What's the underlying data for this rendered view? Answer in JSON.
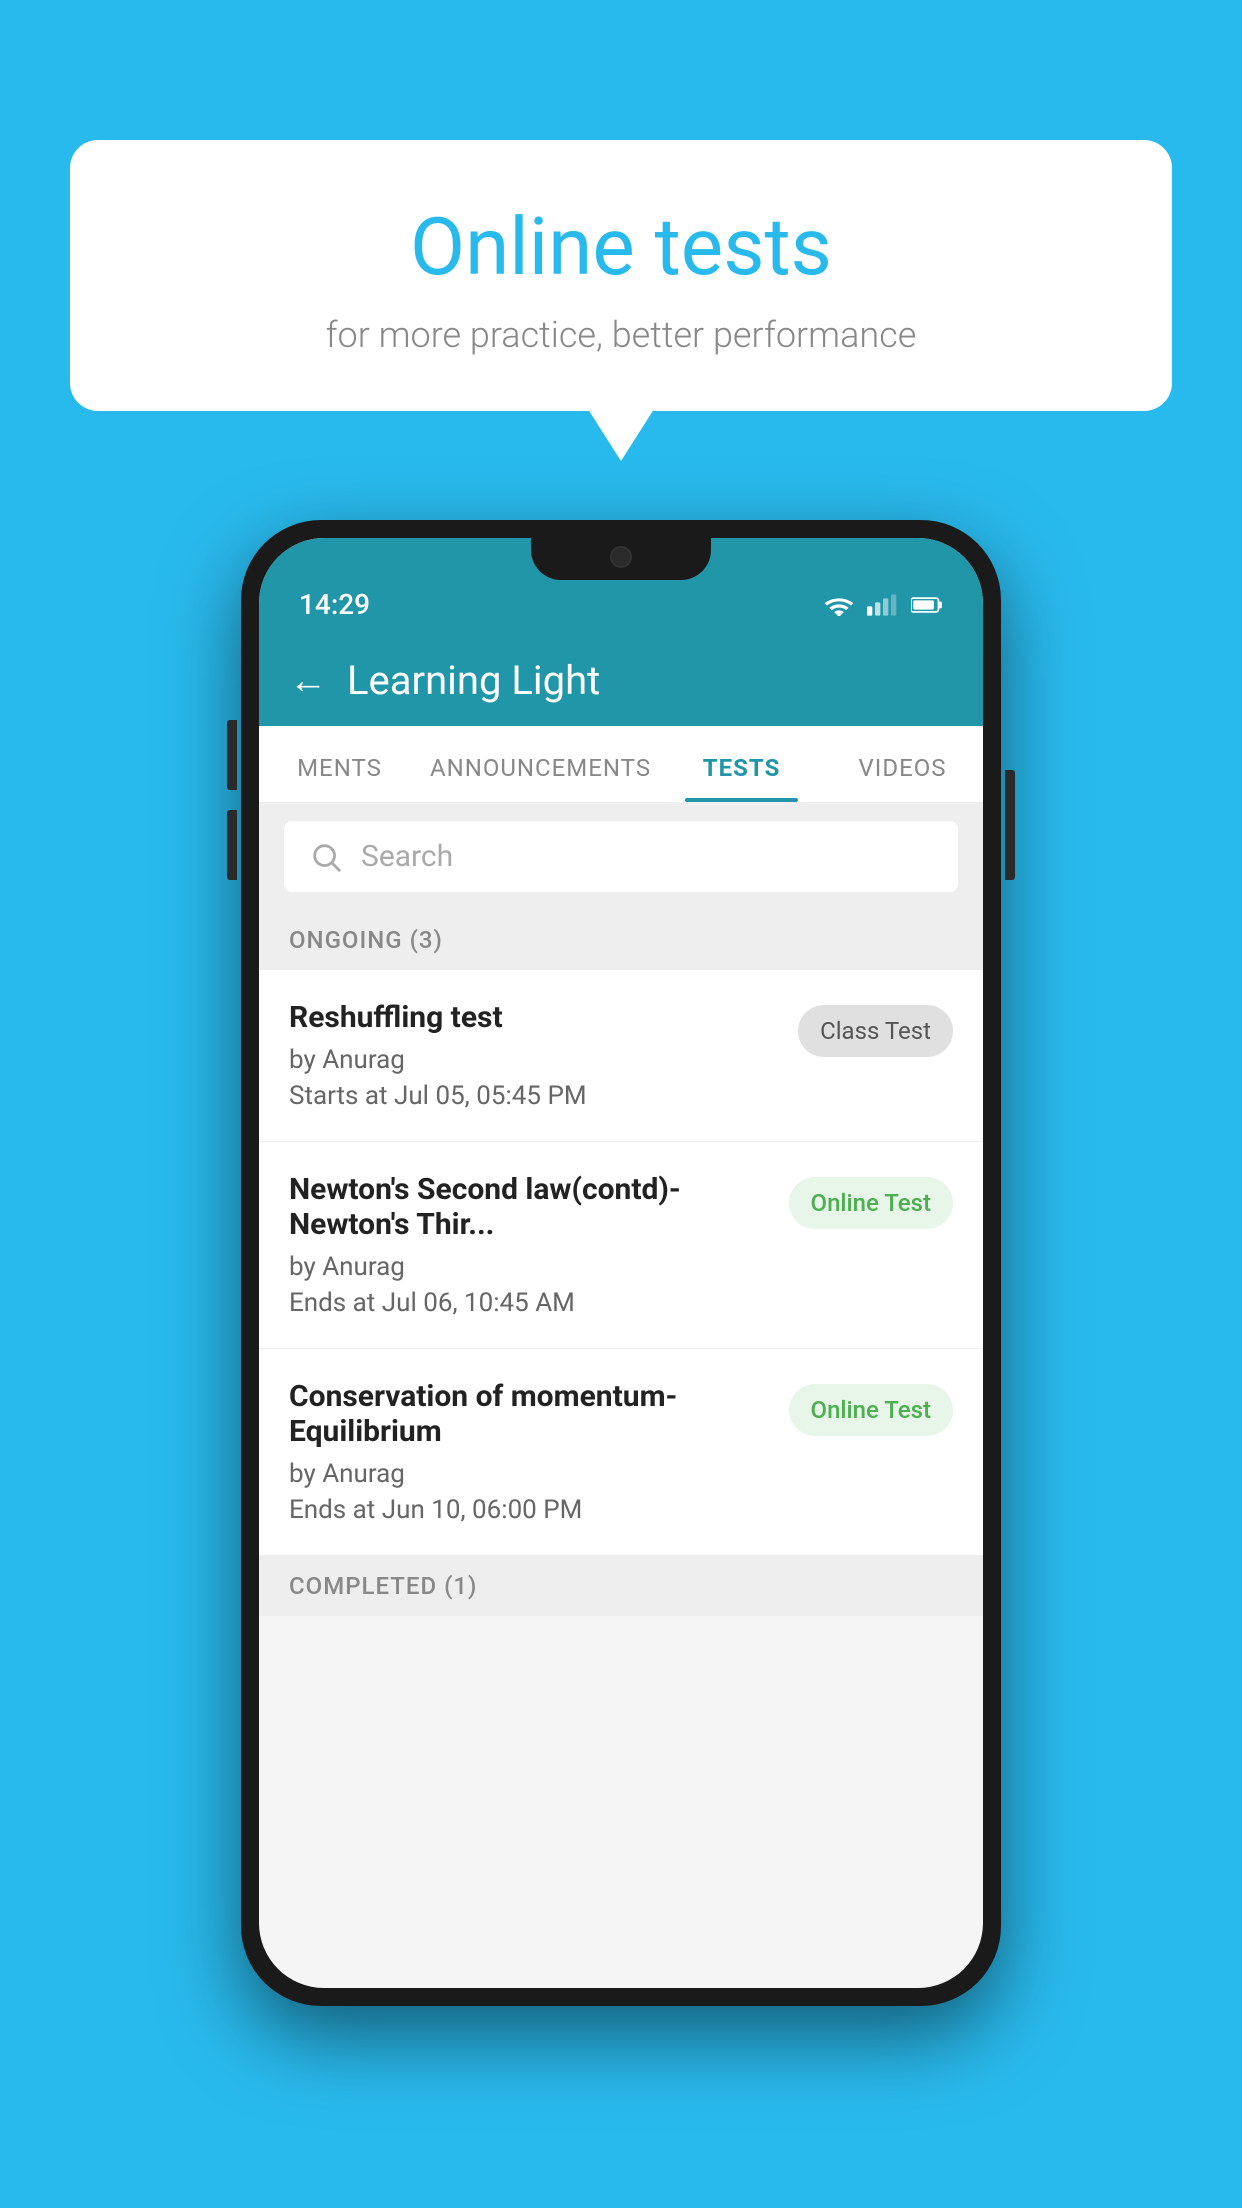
{
  "background": {
    "color": "#29BAED"
  },
  "bubble": {
    "title": "Online tests",
    "subtitle": "for more practice, better performance"
  },
  "phone": {
    "status_bar": {
      "time": "14:29",
      "icons": [
        "wifi",
        "signal",
        "battery"
      ]
    },
    "header": {
      "title": "Learning Light",
      "back_label": "←"
    },
    "tabs": [
      {
        "label": "MENTS",
        "active": false
      },
      {
        "label": "ANNOUNCEMENTS",
        "active": false
      },
      {
        "label": "TESTS",
        "active": true
      },
      {
        "label": "VIDEOS",
        "active": false
      }
    ],
    "search": {
      "placeholder": "Search"
    },
    "ongoing_section": {
      "label": "ONGOING (3)"
    },
    "tests": [
      {
        "title": "Reshuffling test",
        "author": "by Anurag",
        "date": "Starts at  Jul 05, 05:45 PM",
        "badge": "Class Test",
        "badge_type": "class"
      },
      {
        "title": "Newton's Second law(contd)-Newton's Thir...",
        "author": "by Anurag",
        "date": "Ends at  Jul 06, 10:45 AM",
        "badge": "Online Test",
        "badge_type": "online"
      },
      {
        "title": "Conservation of momentum-Equilibrium",
        "author": "by Anurag",
        "date": "Ends at  Jun 10, 06:00 PM",
        "badge": "Online Test",
        "badge_type": "online"
      }
    ],
    "completed_section": {
      "label": "COMPLETED (1)"
    }
  }
}
